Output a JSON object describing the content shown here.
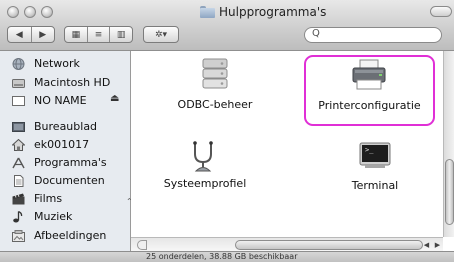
{
  "window": {
    "title": "Hulpprogramma's"
  },
  "toolbar": {
    "back_label": "◀",
    "forward_label": "▶",
    "view_icons": "▦",
    "view_list": "≡",
    "view_columns": "▥",
    "action_label": "✲▾",
    "search_placeholder": "Q"
  },
  "sidebar": {
    "items": [
      {
        "label": "Network",
        "icon": "globe-icon"
      },
      {
        "label": "Macintosh HD",
        "icon": "hard-drive-icon"
      },
      {
        "label": "NO NAME",
        "icon": "removable-drive-icon",
        "eject": "⏏"
      },
      {
        "label": "Bureaublad",
        "icon": "desktop-icon"
      },
      {
        "label": "ek001017",
        "icon": "home-icon"
      },
      {
        "label": "Programma's",
        "icon": "applications-icon"
      },
      {
        "label": "Documenten",
        "icon": "documents-icon"
      },
      {
        "label": "Films",
        "icon": "movies-icon"
      },
      {
        "label": "Muziek",
        "icon": "music-icon"
      },
      {
        "label": "Afbeeldingen",
        "icon": "pictures-icon"
      }
    ]
  },
  "files": [
    {
      "label": "ODBC-beheer",
      "icon": "database-icon"
    },
    {
      "label": "Printerconfiguratie",
      "icon": "printer-icon",
      "selected": true
    },
    {
      "label": "Systeemprofiel",
      "icon": "stethoscope-icon"
    },
    {
      "label": "Terminal",
      "icon": "terminal-icon",
      "terminal_prompt": ">_"
    }
  ],
  "status": {
    "text": "25 onderdelen, 38.88 GB beschikbaar"
  },
  "colors": {
    "selection_outline": "#e02fd6",
    "sidebar_bg": "#e7ebf0"
  }
}
